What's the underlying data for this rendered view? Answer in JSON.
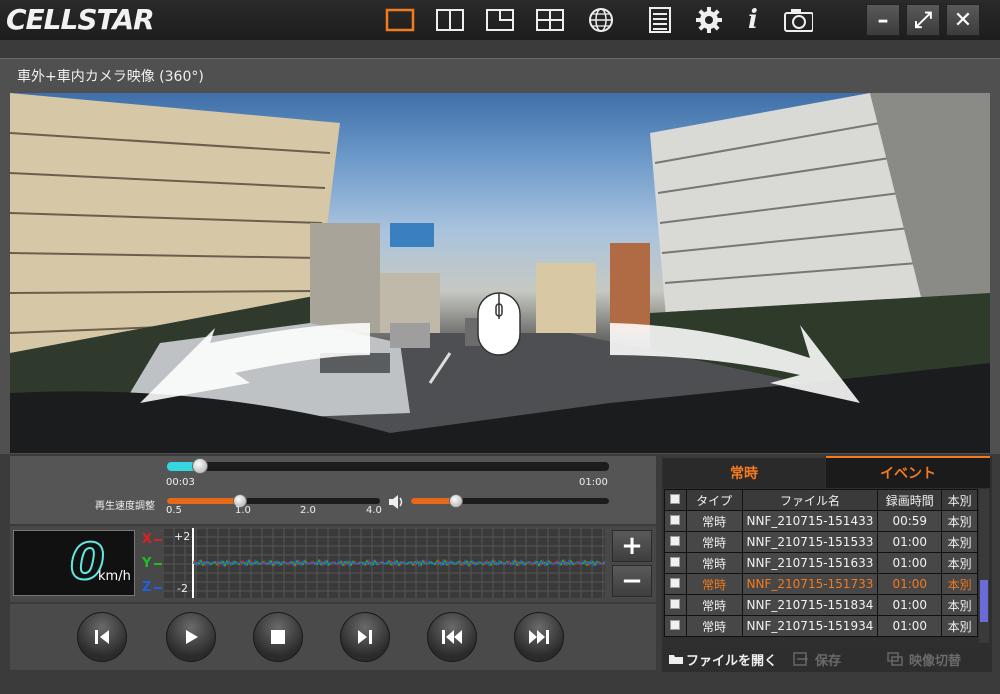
{
  "app": {
    "brand": "CELLSTAR"
  },
  "toolbar": {
    "icons": [
      "single-view-icon",
      "split-view-icon",
      "pip-view-icon",
      "quad-view-icon",
      "globe-icon",
      "list-icon",
      "gear-icon",
      "info-icon",
      "camera-icon"
    ],
    "window_buttons": {
      "minimize": "–",
      "maximize": "⤢",
      "close": "✕"
    }
  },
  "video": {
    "title": "車外+車内カメラ映像 (360°)"
  },
  "playback": {
    "elapsed": "00:03",
    "duration": "01:00",
    "progress": 0.05,
    "speed_label": "再生速度調整",
    "speed_ticks": [
      "0.5",
      "1.0",
      "2.0",
      "4.0"
    ],
    "speed_value": "1.0",
    "volume": 0.22
  },
  "sensor": {
    "speed": "0",
    "speed_unit": "km/h",
    "axes": [
      "X",
      "Y",
      "Z"
    ],
    "scale_top": "+2",
    "scale_bottom": "-2",
    "zoom_in": "+",
    "zoom_out": "−"
  },
  "transport": [
    "skip-to-start-icon",
    "play-icon",
    "stop-icon",
    "next-frame-icon",
    "previous-file-icon",
    "next-file-icon"
  ],
  "filelist": {
    "tabs": {
      "normal": "常時",
      "event": "イベント"
    },
    "columns": {
      "type": "タイプ",
      "filename": "ファイル名",
      "time": "録画時間",
      "kind": "本別"
    },
    "rows": [
      {
        "type": "常時",
        "filename": "NNF_210715-151433",
        "time": "00:59",
        "kind": "本別"
      },
      {
        "type": "常時",
        "filename": "NNF_210715-151533",
        "time": "01:00",
        "kind": "本別"
      },
      {
        "type": "常時",
        "filename": "NNF_210715-151633",
        "time": "01:00",
        "kind": "本別"
      },
      {
        "type": "常時",
        "filename": "NNF_210715-151733",
        "time": "01:00",
        "kind": "本別"
      },
      {
        "type": "常時",
        "filename": "NNF_210715-151834",
        "time": "01:00",
        "kind": "本別"
      },
      {
        "type": "常時",
        "filename": "NNF_210715-151934",
        "time": "01:00",
        "kind": "本別"
      }
    ],
    "actions": {
      "open": "ファイルを開く",
      "save": "保存",
      "switch": "映像切替"
    }
  },
  "colors": {
    "accent": "#f47a1e",
    "speed": "#5ee8e0",
    "x_axis": "#e02020",
    "y_axis": "#20c020",
    "z_axis": "#2060e0"
  }
}
